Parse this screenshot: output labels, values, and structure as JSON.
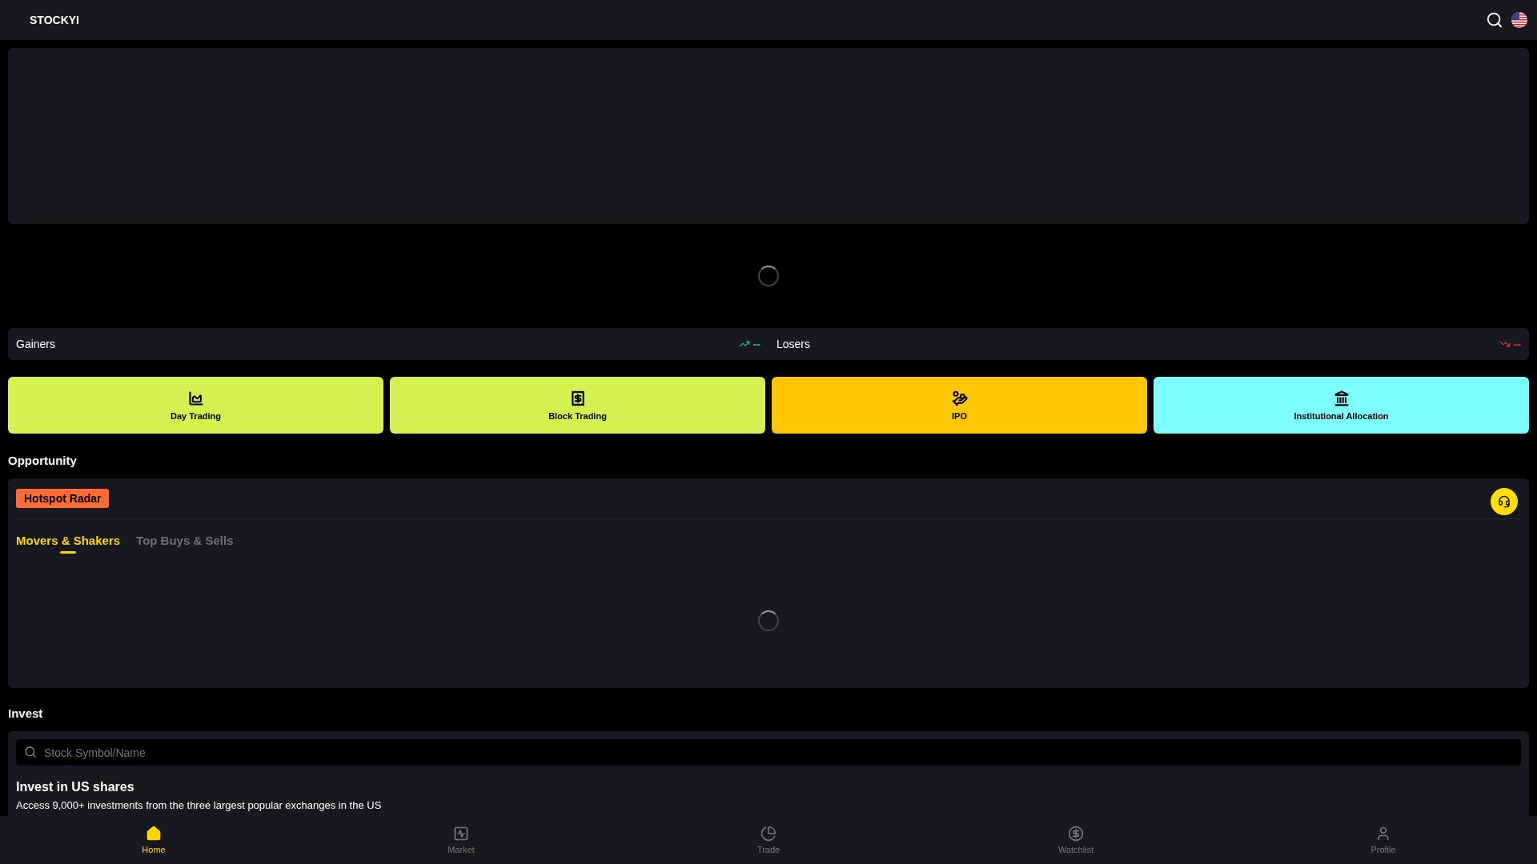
{
  "header": {
    "brand": "STOCKYI"
  },
  "movers": [
    {
      "label": "Gainers",
      "kind": "up",
      "value": "--",
      "color": "#22c58b"
    },
    {
      "label": "Losers",
      "kind": "down",
      "value": "--",
      "color": "#ff2a2a"
    }
  ],
  "features": [
    {
      "label": "Day Trading",
      "color": "#d4f051"
    },
    {
      "label": "Block Trading",
      "color": "#d4f051"
    },
    {
      "label": "IPO",
      "color": "#ffc700"
    },
    {
      "label": "Institutional Allocation",
      "color": "#7dfdfd"
    }
  ],
  "opportunity": {
    "title": "Opportunity",
    "badge": "Hotspot Radar",
    "tabs": [
      {
        "label": "Movers & Shakers",
        "selected": true
      },
      {
        "label": "Top Buys & Sells",
        "selected": false
      }
    ]
  },
  "invest": {
    "title": "Invest",
    "search": {
      "placeholder": "Stock Symbol/Name"
    },
    "heading": "Invest in US shares",
    "description": "Access 9,000+ investments from the three largest popular exchanges in the US"
  },
  "nav": [
    {
      "label": "Home",
      "selected": true
    },
    {
      "label": "Market",
      "selected": false
    },
    {
      "label": "Trade",
      "selected": false
    },
    {
      "label": "Watchlist",
      "selected": false
    },
    {
      "label": "Profile",
      "selected": false
    }
  ]
}
